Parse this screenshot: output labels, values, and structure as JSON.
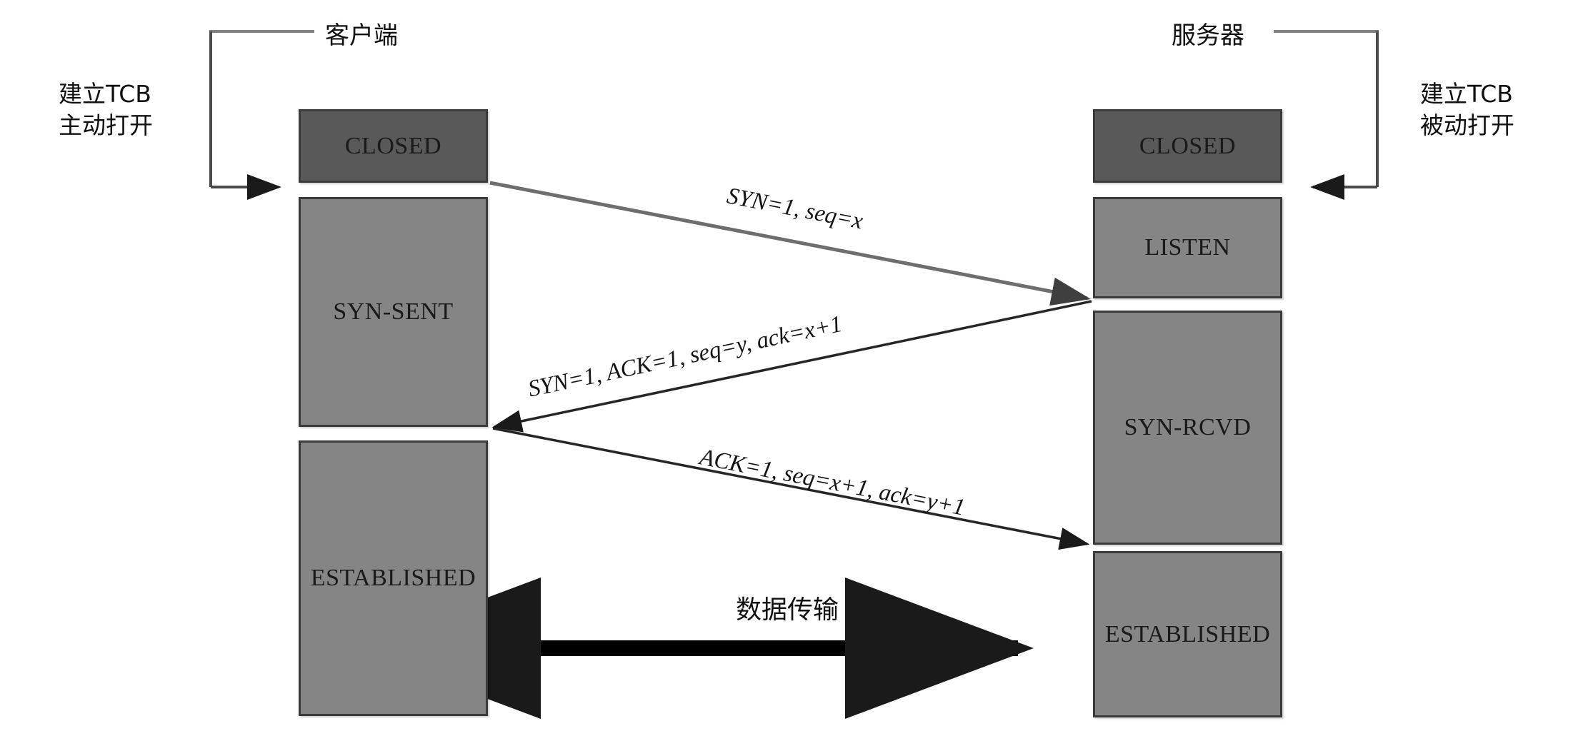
{
  "diagram": {
    "title_client": "客户端",
    "title_server": "服务器",
    "client_note": {
      "line1": "建立TCB",
      "line2": "主动打开"
    },
    "server_note": {
      "line1": "建立TCB",
      "line2": "被动打开"
    },
    "transfer_label": "数据传输",
    "colors": {
      "closed_fill": "#595959",
      "state_fill": "#858585",
      "border": "#3a3a3a",
      "arrow_light": "#6e6e6e",
      "arrow_dark": "#1a1a1a",
      "background": "#ffffff"
    }
  },
  "client_states": [
    {
      "label": "CLOSED",
      "tone": "dark"
    },
    {
      "label": "SYN-SENT",
      "tone": "light"
    },
    {
      "label": "ESTABLISHED",
      "tone": "light"
    }
  ],
  "server_states": [
    {
      "label": "CLOSED",
      "tone": "dark"
    },
    {
      "label": "LISTEN",
      "tone": "light"
    },
    {
      "label": "SYN-RCVD",
      "tone": "light"
    },
    {
      "label": "ESTABLISHED",
      "tone": "light"
    }
  ],
  "messages": [
    {
      "id": "syn",
      "text": "SYN=1,  seq=x",
      "direction": "client-to-server"
    },
    {
      "id": "synack",
      "text": "SYN=1,  ACK=1,  seq=y, ack=x+1",
      "direction": "server-to-client"
    },
    {
      "id": "ack",
      "text": "ACK=1,  seq=x+1, ack=y+1",
      "direction": "client-to-server"
    }
  ]
}
